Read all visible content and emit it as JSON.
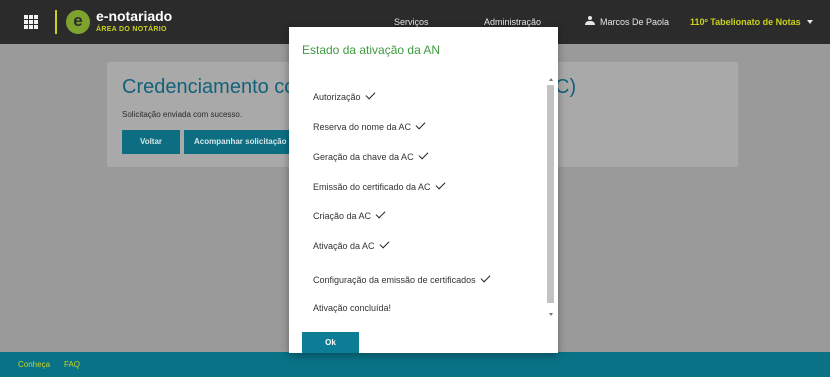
{
  "header": {
    "brand": "e-notariado",
    "brand_sub": "ÁREA DO NOTÁRIO",
    "logo_letter": "e",
    "nav_services": "Serviços",
    "nav_admin": "Administração",
    "user_name": "Marcos De Paola",
    "office": "110º Tabelionato de Notas",
    "icons": {
      "apps": "apps-grid-icon",
      "user": "user-icon",
      "dropdown": "chevron-down-icon"
    }
  },
  "page": {
    "title": "Credenciamento co",
    "title_end": "C)",
    "message": "Solicitação enviada com sucesso.",
    "back_button": "Voltar",
    "follow_button": "Acompanhar solicitação"
  },
  "modal": {
    "title": "Estado da ativação da AN",
    "steps": [
      "Autorização",
      "Reserva do nome da AC",
      "Geração da chave da AC",
      "Emissão do certificado da AC",
      "Criação da AC",
      "Ativação da AC",
      "Configuração da emissão de certificados",
      "Ativação concluída!"
    ],
    "ok_label": "Ok"
  },
  "footer": {
    "link_about": "Conheça",
    "link_faq": "FAQ"
  },
  "colors": {
    "topbar": "#2b2b2b",
    "accent_lime": "#c9d21e",
    "teal": "#0c7d94",
    "modal_title": "#3f9a3f"
  }
}
